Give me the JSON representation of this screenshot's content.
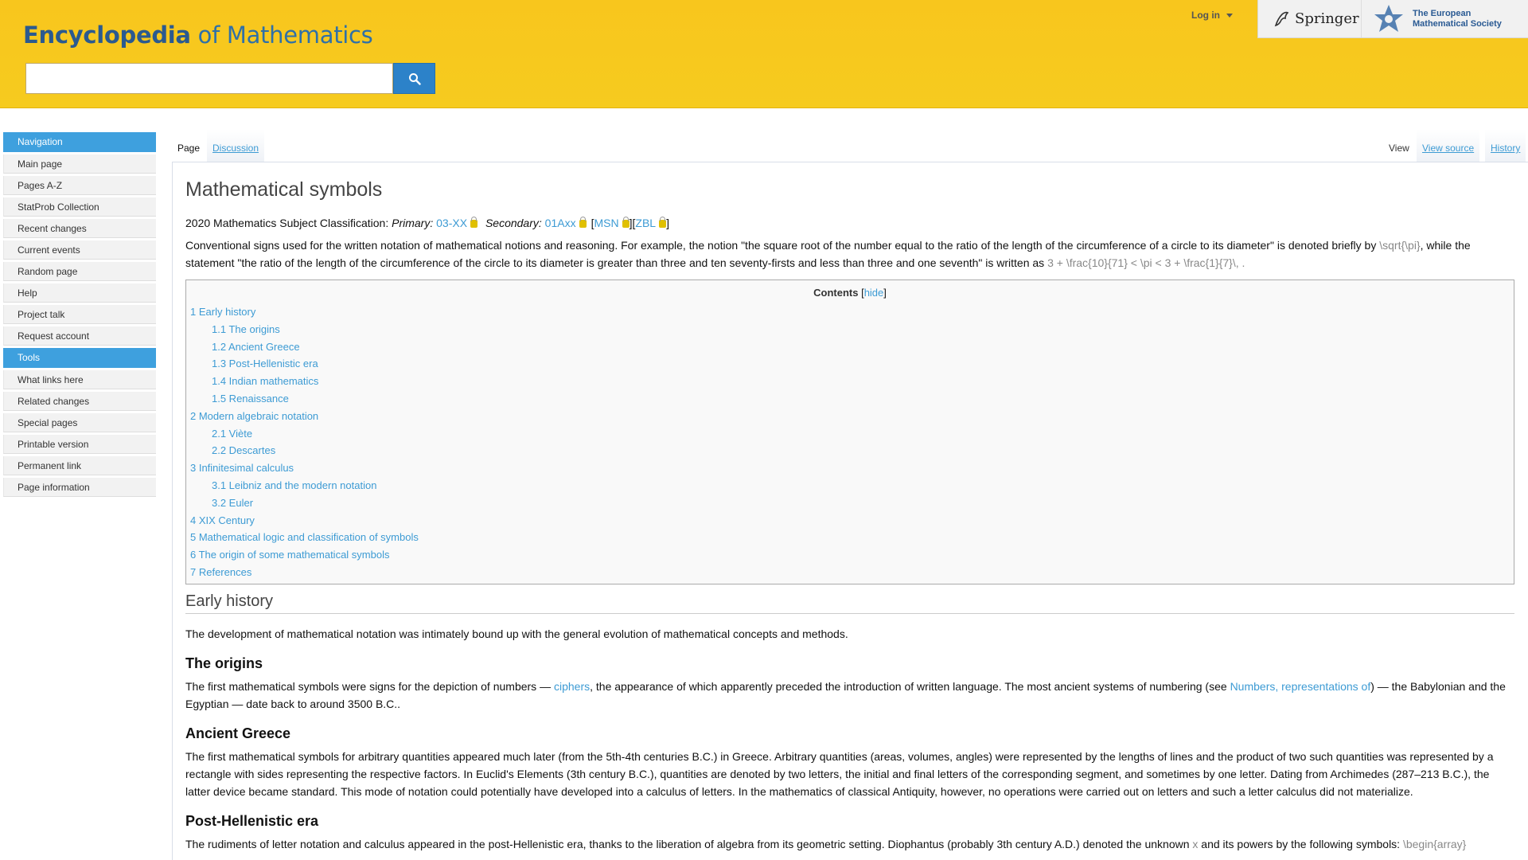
{
  "header": {
    "logo_main": "Encyclopedia",
    "logo_of": " of Mathematics",
    "search_placeholder": "",
    "login_label": "Log in",
    "springer_label": "Springer",
    "ems_line1": "The European",
    "ems_line2": "Mathematical Society"
  },
  "sidebar": {
    "navigation_title": "Navigation",
    "navigation": [
      "Main page",
      "Pages A-Z",
      "StatProb Collection",
      "Recent changes",
      "Current events",
      "Random page",
      "Help",
      "Project talk",
      "Request account"
    ],
    "tools_title": "Tools",
    "tools": [
      "What links here",
      "Related changes",
      "Special pages",
      "Printable version",
      "Permanent link",
      "Page information"
    ]
  },
  "tabs": {
    "page": "Page",
    "discussion": "Discussion",
    "view": "View",
    "view_source": "View source",
    "history": "History"
  },
  "article": {
    "title": "Mathematical symbols",
    "msc_prefix": "2020 Mathematics Subject Classification: ",
    "msc_primary_label": "Primary:",
    "msc_primary_code": "03-XX",
    "msc_secondary_label": "Secondary:",
    "msc_secondary_code": "01Axx",
    "msc_msn": "MSN",
    "msc_zbl": "ZBL",
    "intro_1": "Conventional signs used for the written notation of mathematical notions and reasoning. For example, the notion \"the square root of the number equal to the ratio of the length of the circumference of a circle to its diameter\" is denoted briefly by ",
    "intro_math_1": "\\sqrt{\\pi}",
    "intro_2": ", while the statement \"the ratio of the length of the circumference of the circle to its diameter is greater than three and ten seventy-firsts and less than three and one seventh\" is written as ",
    "intro_math_2": "3 + \\frac{10}{71} < \\pi < 3 + \\frac{1}{7}\\, .",
    "toc_title": "Contents",
    "toc_hide": "hide",
    "toc": [
      {
        "level": 1,
        "text": "1 Early history"
      },
      {
        "level": 2,
        "text": "1.1 The origins"
      },
      {
        "level": 2,
        "text": "1.2 Ancient Greece"
      },
      {
        "level": 2,
        "text": "1.3 Post-Hellenistic era"
      },
      {
        "level": 2,
        "text": "1.4 Indian mathematics"
      },
      {
        "level": 2,
        "text": "1.5 Renaissance"
      },
      {
        "level": 1,
        "text": "2 Modern algebraic notation"
      },
      {
        "level": 2,
        "text": "2.1 Viète"
      },
      {
        "level": 2,
        "text": "2.2 Descartes"
      },
      {
        "level": 1,
        "text": "3 Infinitesimal calculus"
      },
      {
        "level": 2,
        "text": "3.1 Leibniz and the modern notation"
      },
      {
        "level": 2,
        "text": "3.2 Euler"
      },
      {
        "level": 1,
        "text": "4 XIX Century"
      },
      {
        "level": 1,
        "text": "5 Mathematical logic and classification of symbols"
      },
      {
        "level": 1,
        "text": "6 The origin of some mathematical symbols"
      },
      {
        "level": 1,
        "text": "7 References"
      }
    ],
    "section_early": "Early history",
    "early_text": "The development of mathematical notation was intimately bound up with the general evolution of mathematical concepts and methods.",
    "origins_title": "The origins",
    "origins_1": "The first mathematical symbols were signs for the depiction of numbers — ",
    "origins_link1": "ciphers",
    "origins_2": ", the appearance of which apparently preceded the introduction of written language. The most ancient systems of numbering (see ",
    "origins_link2": "Numbers, representations of",
    "origins_3": ") — the Babylonian and the Egyptian — date back to around 3500 B.C..",
    "greece_title": "Ancient Greece",
    "greece_text": "The first mathematical symbols for arbitrary quantities appeared much later (from the 5th-4th centuries B.C.) in Greece. Arbitrary quantities (areas, volumes, angles) were represented by the lengths of lines and the product of two such quantities was represented by a rectangle with sides representing the respective factors. In Euclid's Elements (3th century B.C.), quantities are denoted by two letters, the initial and final letters of the corresponding segment, and sometimes by one letter. Dating from Archimedes (287–213 B.C.), the latter device became standard. This mode of notation could potentially have developed into a calculus of letters. In the mathematics of classical Antiquity, however, no operations were carried out on letters and such a letter calculus did not materialize.",
    "post_title": "Post-Hellenistic era",
    "post_1": "The rudiments of letter notation and calculus appeared in the post-Hellenistic era, thanks to the liberation of algebra from its geometric setting. Diophantus (probably 3th century A.D.) denoted the unknown ",
    "post_math_x": "x",
    "post_2": " and its powers by the following symbols: ",
    "post_math_array": "\\begin{array}"
  }
}
